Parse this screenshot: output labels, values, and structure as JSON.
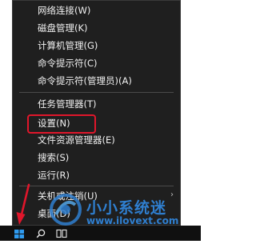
{
  "menu": {
    "items": [
      {
        "label": "网络连接(W)"
      },
      {
        "label": "磁盘管理(K)"
      },
      {
        "label": "计算机管理(G)"
      },
      {
        "label": "命令提示符(C)"
      },
      {
        "label": "命令提示符(管理员)(A)"
      },
      {
        "label": "任务管理器(T)"
      },
      {
        "label": "设置(N)"
      },
      {
        "label": "文件资源管理器(E)"
      },
      {
        "label": "搜索(S)"
      },
      {
        "label": "运行(R)"
      },
      {
        "label": "关机或注销(U)"
      },
      {
        "label": "桌面(D)"
      }
    ],
    "highlighted_item": "设置(N)",
    "highlight_color": "#e0162b",
    "submenu_arrow": "›"
  },
  "taskbar": {
    "start_icon": "windows-logo-icon",
    "search_icon": "search-icon",
    "task_view_icon": "task-view-icon"
  },
  "watermark": {
    "title": "小小系统迷",
    "url": "www.ilovext.com",
    "color": "#2f7fd0"
  }
}
